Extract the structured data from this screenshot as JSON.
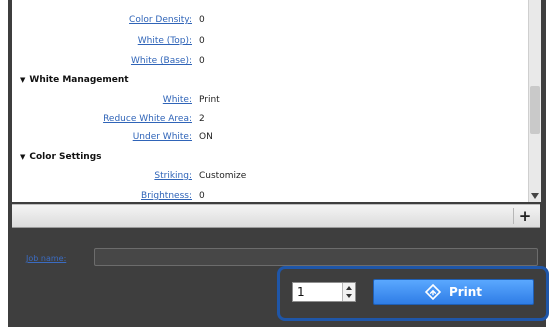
{
  "settings": {
    "rows_top": [
      {
        "label": "Color Density:",
        "value": "0"
      },
      {
        "label": "White (Top):",
        "value": "0"
      },
      {
        "label": "White (Base):",
        "value": "0"
      }
    ],
    "white_management": {
      "title": "White Management",
      "rows": [
        {
          "label": "White:",
          "value": "Print"
        },
        {
          "label": "Reduce White Area:",
          "value": "2"
        },
        {
          "label": "Under White:",
          "value": "ON"
        }
      ]
    },
    "color_settings": {
      "title": "Color Settings",
      "rows": [
        {
          "label": "Striking:",
          "value": "Customize"
        },
        {
          "label": "Brightness:",
          "value": "0"
        }
      ]
    }
  },
  "toolbar": {
    "add_label": "+"
  },
  "job": {
    "label": "Job name:",
    "value": ""
  },
  "copies": {
    "value": "1"
  },
  "print_button": {
    "label": "Print",
    "icon": "print-diamond-icon",
    "color": "#2f7de6"
  },
  "highlight_color": "#1f56a8"
}
